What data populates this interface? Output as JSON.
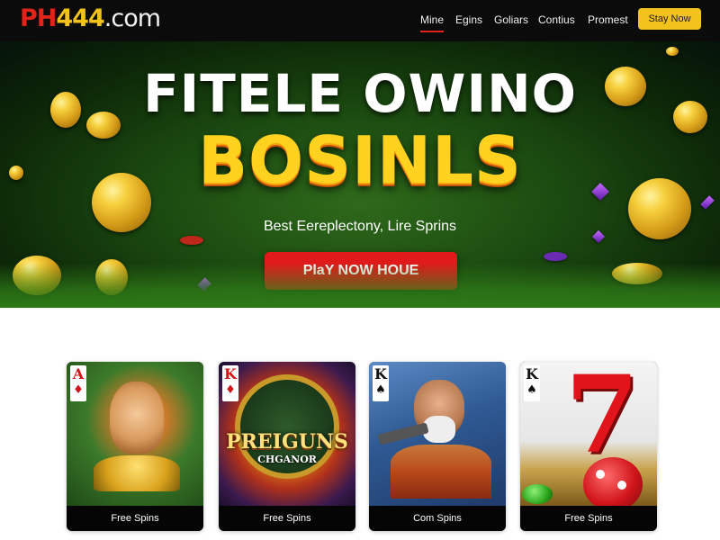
{
  "header": {
    "logo": {
      "ph": "PH",
      "num": "444",
      "dom": ".com"
    },
    "nav": [
      {
        "label": "Mine",
        "active": true
      },
      {
        "label": "Egins",
        "active": false
      },
      {
        "label": "Goliars",
        "active": false
      },
      {
        "label": "Contius",
        "active": false
      },
      {
        "label": "Promest",
        "active": false
      }
    ],
    "cta_label": "Stay Now"
  },
  "hero": {
    "title_line1": "FITELE OWINO",
    "title_line2": "BOSINLS",
    "subtitle": "Best Eereplectony, Lire Sprins",
    "cta_label": "PlaY NOW HOUE"
  },
  "cards": [
    {
      "rank": "A",
      "suit": "♦",
      "art_text": "",
      "art_sub": "",
      "label": "Free Spins"
    },
    {
      "rank": "K",
      "suit": "♦",
      "art_text": "PREIGUNS",
      "art_sub": "CHGANOR",
      "label": "Free Spins"
    },
    {
      "rank": "K",
      "suit": "♠",
      "art_text": "",
      "art_sub": "",
      "label": "Com Spins"
    },
    {
      "rank": "K",
      "suit": "♠",
      "art_text": "7",
      "art_sub": "",
      "label": "Free Spins"
    }
  ],
  "colors": {
    "brand_red": "#e2231a",
    "brand_gold": "#f4c21d",
    "header_bg": "#0b0b0b",
    "hero_green": "#1b4a10"
  },
  "icons": [
    "coin-icon",
    "gem-icon",
    "poker-chip-icon",
    "spade-suit-icon",
    "diamond-suit-icon"
  ]
}
